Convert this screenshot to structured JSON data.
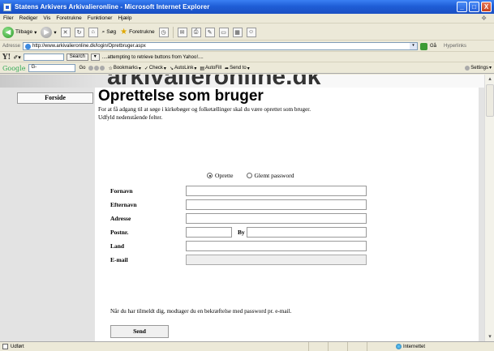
{
  "window": {
    "title": "Statens Arkivers Arkivalieronline - Microsoft Internet Explorer",
    "min": "_",
    "max": "□",
    "close": "X"
  },
  "menu": [
    "Filer",
    "Rediger",
    "Vis",
    "Foretrukne",
    "Funktioner",
    "Hjælp"
  ],
  "toolbar": {
    "back": "Tilbage",
    "search": "Søg",
    "favorites": "Foretrukne"
  },
  "address": {
    "label": "Adresse",
    "url": "http://www.arkivalieronline.dk/login/Opretbruger.aspx",
    "go": "Gå",
    "links": "Hyperlinks"
  },
  "yahoo": {
    "logo": "Y!",
    "search_button": "Search",
    "status": "....attempting to retrieve buttons from Yahoo!...."
  },
  "google": {
    "logo": "Google",
    "field": "G-",
    "go": "Go",
    "bookmarks": "Bookmarks",
    "check": "Check",
    "autolink": "AutoLink",
    "autofill": "AutoFill",
    "sendto": "Send to",
    "settings": "Settings"
  },
  "site": {
    "name": "arkivalieronline.dk",
    "nav_forside": "Forside"
  },
  "page": {
    "title": "Oprettelse som bruger",
    "intro_1": "For at få adgang til at søge i kirkebøger og folketællinger skal du være oprettet som bruger.",
    "intro_2": "Udfyld nedenstående felter.",
    "radio_opret": "Oprette",
    "radio_glemt": "Glemt password",
    "labels": {
      "fornavn": "Fornavn",
      "efternavn": "Efternavn",
      "adresse": "Adresse",
      "postnr": "Postnr.",
      "by": "By",
      "land": "Land",
      "email": "E-mail"
    },
    "note": "Når du har tilmeldt dig, modtager du en bekræftelse med password pr. e-mail.",
    "send": "Send"
  },
  "status": {
    "left": "Udført",
    "zone": "Internettet"
  }
}
